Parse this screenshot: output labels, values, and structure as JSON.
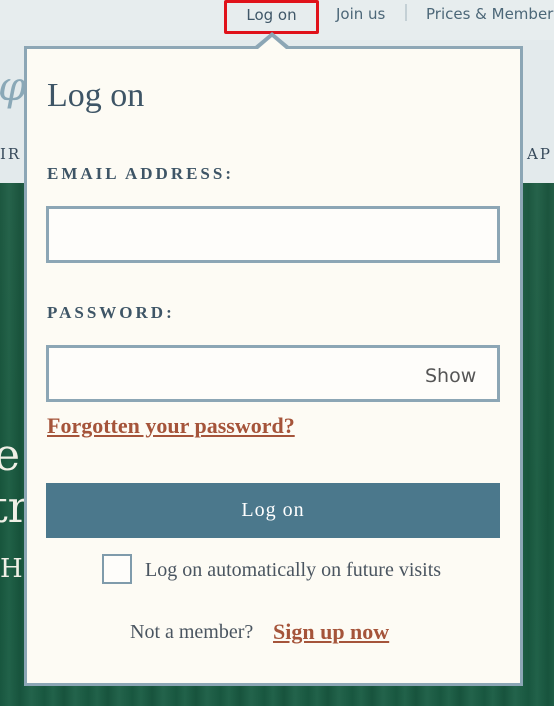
{
  "topnav": {
    "login_label": "Log on",
    "join_label": "Join us",
    "prices_label": "Prices & Members"
  },
  "background": {
    "nav_left_fragment": "IR",
    "nav_right_fragment": "AP",
    "hero_line1_fragment": "e v",
    "hero_line2_fragment": "tr",
    "hero_line3_fragment": "H"
  },
  "popup": {
    "title": "Log on",
    "email_label": "EMAIL ADDRESS:",
    "email_value": "",
    "password_label": "PASSWORD:",
    "password_value": "",
    "show_label": "Show",
    "forgot_link": "Forgotten your password?",
    "login_button": "Log on",
    "remember_label": "Log on automatically on future visits",
    "remember_checked": false,
    "not_member_text": "Not a member?",
    "signup_link": "Sign up now"
  },
  "colors": {
    "accent_button": "#4b788c",
    "link": "#a5543a",
    "border": "#8ca6b5",
    "highlight_box": "#e0121a",
    "hero_green": "#1f5e45"
  }
}
